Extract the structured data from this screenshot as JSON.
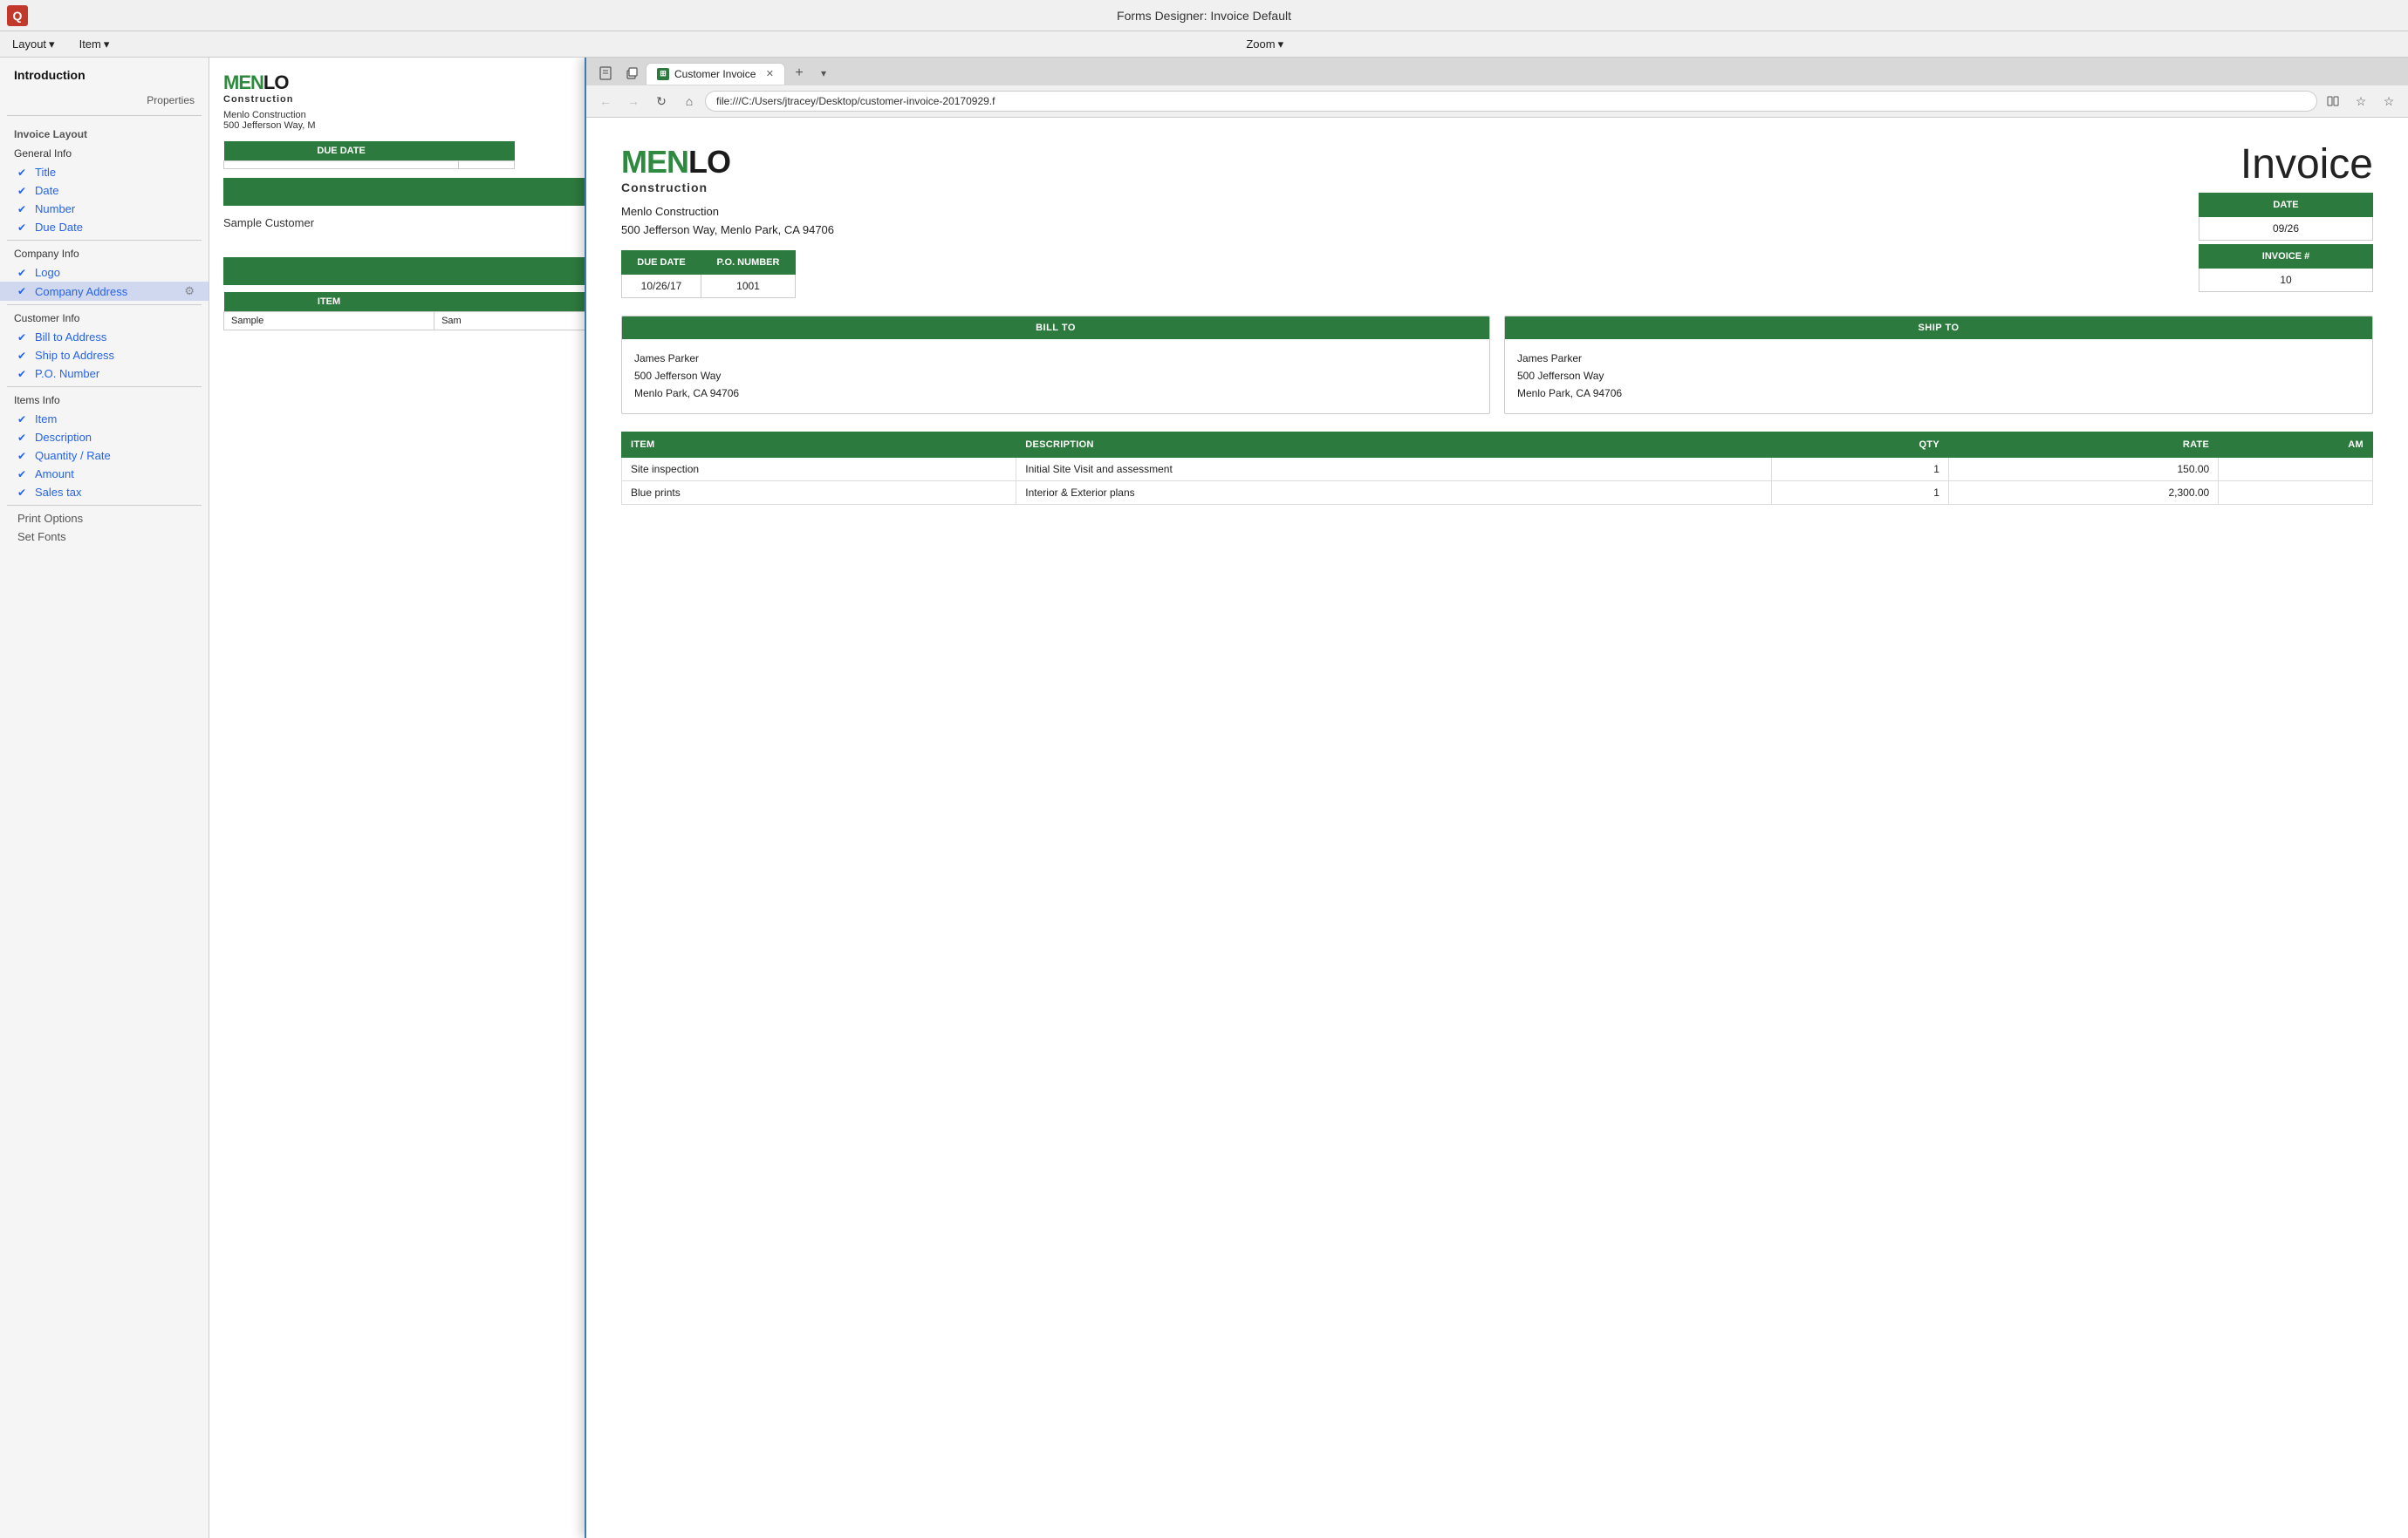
{
  "titleBar": {
    "appIcon": "Q",
    "title": "Forms Designer:  Invoice Default"
  },
  "menuBar": {
    "items": [
      {
        "label": "Layout",
        "hasArrow": true
      },
      {
        "label": "Item",
        "hasArrow": true
      },
      {
        "label": "Zoom",
        "hasArrow": true
      }
    ]
  },
  "sidebar": {
    "header": "Introduction",
    "propertiesLabel": "Properties",
    "sections": [
      {
        "label": "Invoice Layout",
        "subsections": [
          {
            "label": "General Info",
            "items": [
              {
                "label": "Title",
                "checked": true
              },
              {
                "label": "Date",
                "checked": true
              },
              {
                "label": "Number",
                "checked": true
              },
              {
                "label": "Due Date",
                "checked": true
              }
            ]
          },
          {
            "label": "Company Info",
            "items": [
              {
                "label": "Logo",
                "checked": true
              },
              {
                "label": "Company Address",
                "checked": true,
                "hasSettings": true
              }
            ]
          },
          {
            "label": "Customer Info",
            "items": [
              {
                "label": "Bill to Address",
                "checked": true
              },
              {
                "label": "Ship to Address",
                "checked": true
              },
              {
                "label": "P.O. Number",
                "checked": true
              }
            ]
          },
          {
            "label": "Items Info",
            "items": [
              {
                "label": "Item",
                "checked": true
              },
              {
                "label": "Description",
                "checked": true
              },
              {
                "label": "Quantity / Rate",
                "checked": true
              },
              {
                "label": "Amount",
                "checked": true
              },
              {
                "label": "Sales tax",
                "checked": true
              }
            ]
          },
          {
            "label": "Print Options",
            "plain": true
          },
          {
            "label": "Set Fonts",
            "plain": true
          }
        ]
      }
    ]
  },
  "leftPanel": {
    "logoMenlo": "MEN",
    "logoLo": "LO",
    "logoConstruction": "Construction",
    "companyName": "Menlo Construction",
    "companyAddress": "500 Jefferson Way, M",
    "dueDateHeader": "DUE DATE",
    "customerName": "Sample Customer",
    "itemHeader": "ITEM",
    "sampleItem": "Sample",
    "sampleItem2": "Sam"
  },
  "browser": {
    "tabTitle": "Customer Invoice",
    "tabFavicon": "⊞",
    "addressBar": "file:///C:/Users/jtracey/Desktop/customer-invoice-20170929.f",
    "newTabLabel": "+",
    "navButtons": {
      "back": "←",
      "forward": "→",
      "refresh": "↻",
      "home": "⌂"
    }
  },
  "invoice": {
    "title": "Invoice",
    "logoMenlo": "MEN",
    "logoLo": "LO",
    "logoConstruction": "Construction",
    "companyName": "Menlo Construction",
    "companyAddress": "500 Jefferson Way, Menlo Park, CA 94706",
    "invoiceTitleLarge": "Invoice",
    "dateHeader": "DATE",
    "dateValue": "09/26",
    "invoiceHeader": "INVOICE #",
    "invoiceValue": "10",
    "dueDateHeader": "DUE DATE",
    "dueDateValue": "10/26/17",
    "poNumberHeader": "P.O. NUMBER",
    "poNumberValue": "1001",
    "billToHeader": "BILL TO",
    "billToName": "James Parker",
    "billToAddress1": "500 Jefferson Way",
    "billToAddress2": "Menlo Park, CA 94706",
    "shipToHeader": "SHIP TO",
    "shipToName": "James Parker",
    "shipToAddress1": "500 Jefferson Way",
    "shipToAddress2": "Menlo Park, CA 94706",
    "tableHeaders": {
      "item": "ITEM",
      "description": "DESCRIPTION",
      "qty": "QTY",
      "rate": "RATE",
      "amount": "AM"
    },
    "items": [
      {
        "item": "Site inspection",
        "description": "Initial Site Visit and assessment",
        "qty": "1",
        "rate": "150.00"
      },
      {
        "item": "Blue prints",
        "description": "Interior & Exterior plans",
        "qty": "1",
        "rate": "2,300.00"
      }
    ]
  }
}
